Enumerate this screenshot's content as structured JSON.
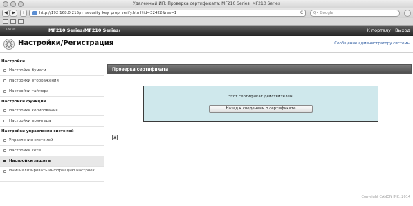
{
  "window": {
    "title": "Удаленный ИП: Проверка сертификата: MF210 Series: MF210 Series"
  },
  "toolbar": {
    "back_label": "◀",
    "forward_label": "▶",
    "add_label": "+",
    "url": "http://192.168.0.215/rr_security_key_prop_verify.html?id=32422&res=1",
    "reload_label": "C",
    "search_placeholder": "Q• Google"
  },
  "banner": {
    "logo": "CANON",
    "model": "MF210 Series/MF210 Series/",
    "portal_link": "К порталу",
    "logout_link": "Выход"
  },
  "subheader": {
    "heading": "Настройки/Регистрация",
    "admin_message": "Сообщение администратору системы"
  },
  "sidebar": {
    "sections": [
      {
        "title": "Настройки",
        "items": [
          {
            "label": "Настройки бумаги"
          },
          {
            "label": "Настройки отображения"
          },
          {
            "label": "Настройки таймера"
          }
        ]
      },
      {
        "title": "Настройки функций",
        "items": [
          {
            "label": "Настройки копирования"
          },
          {
            "label": "Настройки принтера"
          }
        ]
      },
      {
        "title": "Настройки управления системой",
        "items": [
          {
            "label": "Управление системой"
          },
          {
            "label": "Настройки сети"
          },
          {
            "label": "Настройки защиты"
          },
          {
            "label": "Инициализировать информацию настроек"
          }
        ]
      }
    ]
  },
  "main": {
    "title": "Проверка сертификата",
    "message": "Этот сертификат действителен.",
    "back_button": "Назад к сведениям о сертификате",
    "top_icon": "▲"
  },
  "footer": {
    "copyright": "Copyright CANON INC. 2014"
  },
  "colors": {
    "message_box_bg": "#cfe8ec",
    "banner_bg": "#242424",
    "link": "#2c5aa0"
  }
}
